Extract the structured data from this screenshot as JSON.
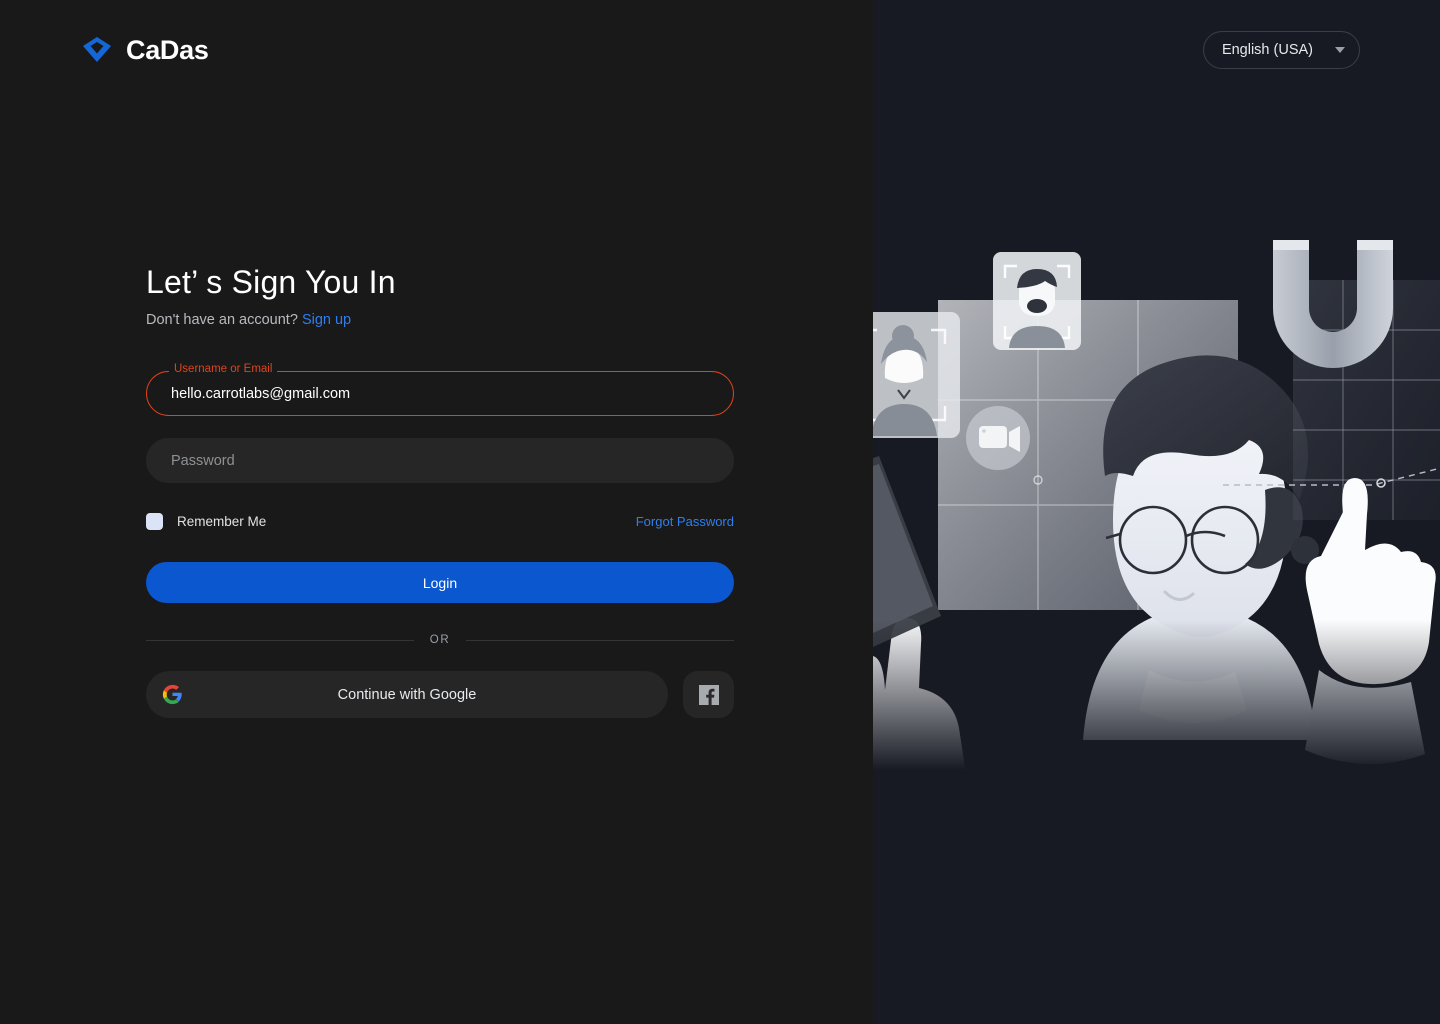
{
  "brand": {
    "name": "CaDas",
    "logo_icon": "diamond-icon",
    "logo_color": "#1467d8"
  },
  "header": {
    "language": {
      "label": "English (USA)",
      "caret_icon": "chevron-down-icon"
    }
  },
  "form": {
    "title": "Let’ s Sign You In",
    "subtitle_text": "Don't have an account? ",
    "signup_link": "Sign up",
    "username_field": {
      "label": "Username or Email",
      "value": "hello.carrotlabs@gmail.com",
      "state": "error",
      "error_color": "#e0431c"
    },
    "password_field": {
      "placeholder": "Password",
      "value": ""
    },
    "remember_me": {
      "label": "Remember Me",
      "checked": false
    },
    "forgot_password": "Forgot Password",
    "login_button": "Login",
    "login_button_color": "#0b57d0",
    "divider_label": "OR",
    "google_button": {
      "label": "Continue with Google",
      "icon": "google-g-icon"
    },
    "facebook_button": {
      "icon": "facebook-f-icon"
    },
    "link_color": "#2f7ef0"
  },
  "illustration": {
    "alt": "grayscale illustration of a person with glasses holding a phone beside floating avatar cards, a magnet and a pointing hand",
    "background_color": "#171a23"
  }
}
